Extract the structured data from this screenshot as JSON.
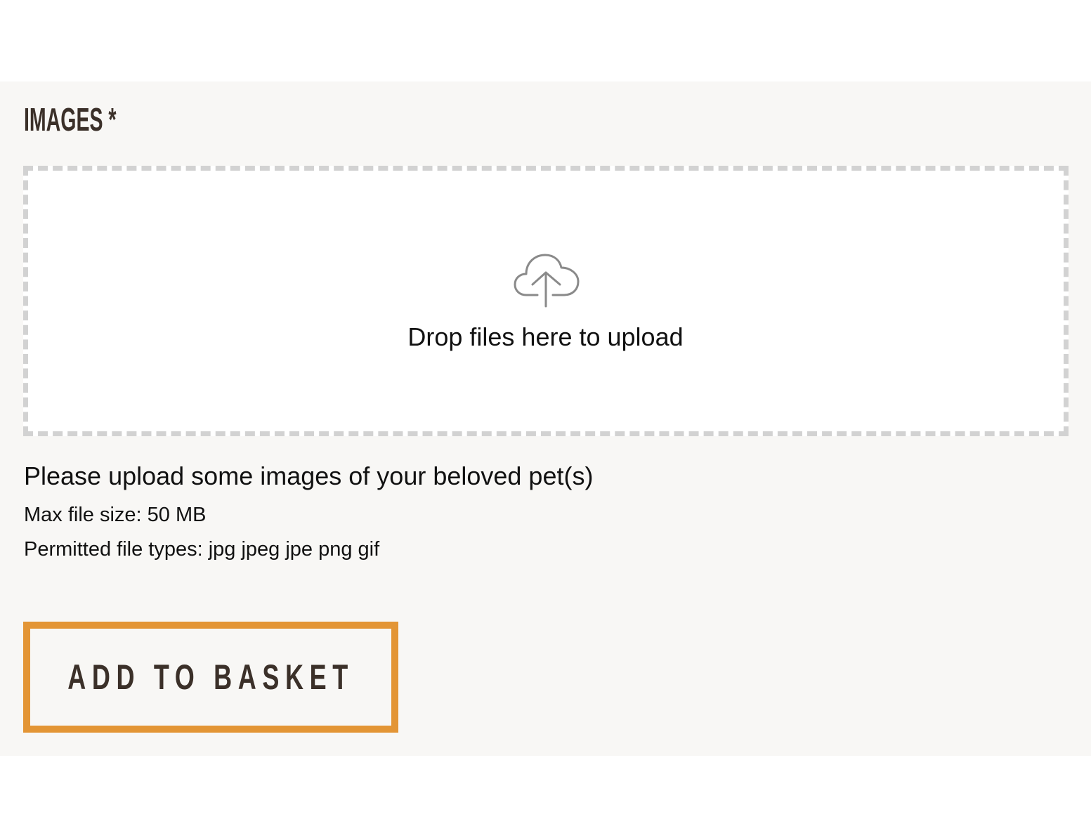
{
  "field": {
    "label": "IMAGES *",
    "required": true
  },
  "dropzone": {
    "icon": "cloud-upload-icon",
    "message": "Drop files here to upload"
  },
  "help": {
    "description": "Please upload some images of your beloved pet(s)",
    "max_file_size": "Max file size: 50 MB",
    "permitted_types": "Permitted file types: jpg jpeg jpe png gif"
  },
  "actions": {
    "add_to_basket": "ADD TO BASKET"
  },
  "colors": {
    "panel_bg": "#f8f7f5",
    "heading_text": "#3b3029",
    "dropzone_border": "#d2d2d2",
    "icon_gray": "#8a8a8a",
    "button_border": "#e39535"
  }
}
